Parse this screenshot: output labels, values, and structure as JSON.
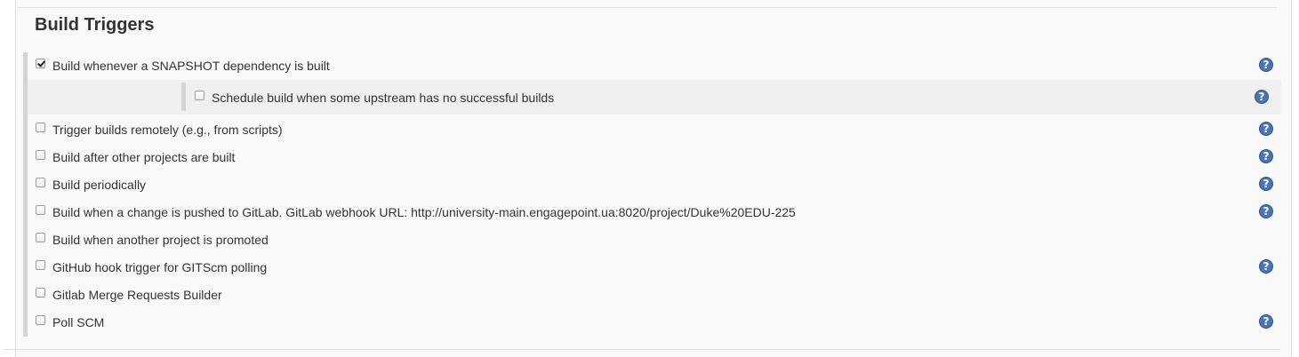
{
  "section": {
    "title": "Build Triggers"
  },
  "triggers": [
    {
      "label": "Build whenever a SNAPSHOT dependency is built",
      "checked": true,
      "help": true
    },
    {
      "label": "Schedule build when some upstream has no successful builds",
      "checked": false,
      "help": true,
      "nested": true
    },
    {
      "label": "Trigger builds remotely (e.g., from scripts)",
      "checked": false,
      "help": true
    },
    {
      "label": "Build after other projects are built",
      "checked": false,
      "help": true
    },
    {
      "label": "Build periodically",
      "checked": false,
      "help": true
    },
    {
      "label": "Build when a change is pushed to GitLab. GitLab webhook URL: http://university-main.engagepoint.ua:8020/project/Duke%20EDU-225",
      "checked": false,
      "help": true
    },
    {
      "label": "Build when another project is promoted",
      "checked": false,
      "help": false
    },
    {
      "label": "GitHub hook trigger for GITScm polling",
      "checked": false,
      "help": true
    },
    {
      "label": "Gitlab Merge Requests Builder",
      "checked": false,
      "help": false
    },
    {
      "label": "Poll SCM",
      "checked": false,
      "help": true
    }
  ],
  "icons": {
    "help": "help-icon",
    "checkbox": "checkbox"
  },
  "colors": {
    "help_icon": "#4a74b4",
    "panel_background": "#f9f9f9",
    "nested_background": "#f0f0f0"
  }
}
